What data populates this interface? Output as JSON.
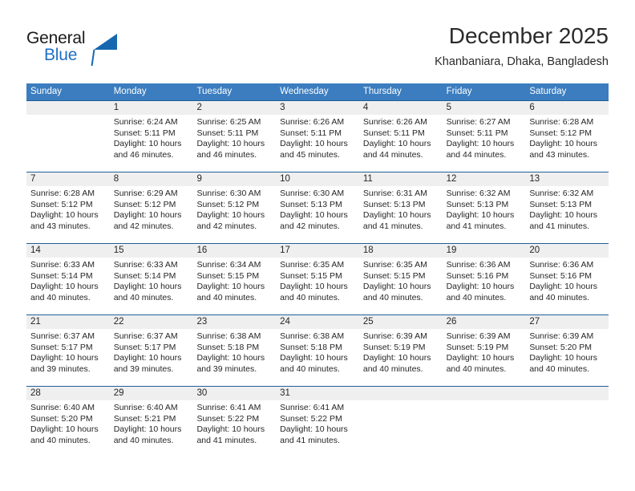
{
  "brand": {
    "word_one": "General",
    "word_two": "Blue"
  },
  "header": {
    "title": "December 2025",
    "subtitle": "Khanbaniara, Dhaka, Bangladesh"
  },
  "colors": {
    "header_blue": "#3b7dbf",
    "rule_blue": "#1f6099",
    "datenum_band": "#efefef",
    "brand_blue": "#1f6fc4",
    "text": "#262626"
  },
  "weekdays": [
    "Sunday",
    "Monday",
    "Tuesday",
    "Wednesday",
    "Thursday",
    "Friday",
    "Saturday"
  ],
  "weeks": [
    {
      "days": [
        {
          "num": "",
          "sunrise": "",
          "sunset": "",
          "daylight_1": "",
          "daylight_2": "",
          "empty": true
        },
        {
          "num": "1",
          "sunrise": "Sunrise: 6:24 AM",
          "sunset": "Sunset: 5:11 PM",
          "daylight_1": "Daylight: 10 hours",
          "daylight_2": "and 46 minutes."
        },
        {
          "num": "2",
          "sunrise": "Sunrise: 6:25 AM",
          "sunset": "Sunset: 5:11 PM",
          "daylight_1": "Daylight: 10 hours",
          "daylight_2": "and 46 minutes."
        },
        {
          "num": "3",
          "sunrise": "Sunrise: 6:26 AM",
          "sunset": "Sunset: 5:11 PM",
          "daylight_1": "Daylight: 10 hours",
          "daylight_2": "and 45 minutes."
        },
        {
          "num": "4",
          "sunrise": "Sunrise: 6:26 AM",
          "sunset": "Sunset: 5:11 PM",
          "daylight_1": "Daylight: 10 hours",
          "daylight_2": "and 44 minutes."
        },
        {
          "num": "5",
          "sunrise": "Sunrise: 6:27 AM",
          "sunset": "Sunset: 5:11 PM",
          "daylight_1": "Daylight: 10 hours",
          "daylight_2": "and 44 minutes."
        },
        {
          "num": "6",
          "sunrise": "Sunrise: 6:28 AM",
          "sunset": "Sunset: 5:12 PM",
          "daylight_1": "Daylight: 10 hours",
          "daylight_2": "and 43 minutes."
        }
      ]
    },
    {
      "days": [
        {
          "num": "7",
          "sunrise": "Sunrise: 6:28 AM",
          "sunset": "Sunset: 5:12 PM",
          "daylight_1": "Daylight: 10 hours",
          "daylight_2": "and 43 minutes."
        },
        {
          "num": "8",
          "sunrise": "Sunrise: 6:29 AM",
          "sunset": "Sunset: 5:12 PM",
          "daylight_1": "Daylight: 10 hours",
          "daylight_2": "and 42 minutes."
        },
        {
          "num": "9",
          "sunrise": "Sunrise: 6:30 AM",
          "sunset": "Sunset: 5:12 PM",
          "daylight_1": "Daylight: 10 hours",
          "daylight_2": "and 42 minutes."
        },
        {
          "num": "10",
          "sunrise": "Sunrise: 6:30 AM",
          "sunset": "Sunset: 5:13 PM",
          "daylight_1": "Daylight: 10 hours",
          "daylight_2": "and 42 minutes."
        },
        {
          "num": "11",
          "sunrise": "Sunrise: 6:31 AM",
          "sunset": "Sunset: 5:13 PM",
          "daylight_1": "Daylight: 10 hours",
          "daylight_2": "and 41 minutes."
        },
        {
          "num": "12",
          "sunrise": "Sunrise: 6:32 AM",
          "sunset": "Sunset: 5:13 PM",
          "daylight_1": "Daylight: 10 hours",
          "daylight_2": "and 41 minutes."
        },
        {
          "num": "13",
          "sunrise": "Sunrise: 6:32 AM",
          "sunset": "Sunset: 5:13 PM",
          "daylight_1": "Daylight: 10 hours",
          "daylight_2": "and 41 minutes."
        }
      ]
    },
    {
      "days": [
        {
          "num": "14",
          "sunrise": "Sunrise: 6:33 AM",
          "sunset": "Sunset: 5:14 PM",
          "daylight_1": "Daylight: 10 hours",
          "daylight_2": "and 40 minutes."
        },
        {
          "num": "15",
          "sunrise": "Sunrise: 6:33 AM",
          "sunset": "Sunset: 5:14 PM",
          "daylight_1": "Daylight: 10 hours",
          "daylight_2": "and 40 minutes."
        },
        {
          "num": "16",
          "sunrise": "Sunrise: 6:34 AM",
          "sunset": "Sunset: 5:15 PM",
          "daylight_1": "Daylight: 10 hours",
          "daylight_2": "and 40 minutes."
        },
        {
          "num": "17",
          "sunrise": "Sunrise: 6:35 AM",
          "sunset": "Sunset: 5:15 PM",
          "daylight_1": "Daylight: 10 hours",
          "daylight_2": "and 40 minutes."
        },
        {
          "num": "18",
          "sunrise": "Sunrise: 6:35 AM",
          "sunset": "Sunset: 5:15 PM",
          "daylight_1": "Daylight: 10 hours",
          "daylight_2": "and 40 minutes."
        },
        {
          "num": "19",
          "sunrise": "Sunrise: 6:36 AM",
          "sunset": "Sunset: 5:16 PM",
          "daylight_1": "Daylight: 10 hours",
          "daylight_2": "and 40 minutes."
        },
        {
          "num": "20",
          "sunrise": "Sunrise: 6:36 AM",
          "sunset": "Sunset: 5:16 PM",
          "daylight_1": "Daylight: 10 hours",
          "daylight_2": "and 40 minutes."
        }
      ]
    },
    {
      "days": [
        {
          "num": "21",
          "sunrise": "Sunrise: 6:37 AM",
          "sunset": "Sunset: 5:17 PM",
          "daylight_1": "Daylight: 10 hours",
          "daylight_2": "and 39 minutes."
        },
        {
          "num": "22",
          "sunrise": "Sunrise: 6:37 AM",
          "sunset": "Sunset: 5:17 PM",
          "daylight_1": "Daylight: 10 hours",
          "daylight_2": "and 39 minutes."
        },
        {
          "num": "23",
          "sunrise": "Sunrise: 6:38 AM",
          "sunset": "Sunset: 5:18 PM",
          "daylight_1": "Daylight: 10 hours",
          "daylight_2": "and 39 minutes."
        },
        {
          "num": "24",
          "sunrise": "Sunrise: 6:38 AM",
          "sunset": "Sunset: 5:18 PM",
          "daylight_1": "Daylight: 10 hours",
          "daylight_2": "and 40 minutes."
        },
        {
          "num": "25",
          "sunrise": "Sunrise: 6:39 AM",
          "sunset": "Sunset: 5:19 PM",
          "daylight_1": "Daylight: 10 hours",
          "daylight_2": "and 40 minutes."
        },
        {
          "num": "26",
          "sunrise": "Sunrise: 6:39 AM",
          "sunset": "Sunset: 5:19 PM",
          "daylight_1": "Daylight: 10 hours",
          "daylight_2": "and 40 minutes."
        },
        {
          "num": "27",
          "sunrise": "Sunrise: 6:39 AM",
          "sunset": "Sunset: 5:20 PM",
          "daylight_1": "Daylight: 10 hours",
          "daylight_2": "and 40 minutes."
        }
      ]
    },
    {
      "days": [
        {
          "num": "28",
          "sunrise": "Sunrise: 6:40 AM",
          "sunset": "Sunset: 5:20 PM",
          "daylight_1": "Daylight: 10 hours",
          "daylight_2": "and 40 minutes."
        },
        {
          "num": "29",
          "sunrise": "Sunrise: 6:40 AM",
          "sunset": "Sunset: 5:21 PM",
          "daylight_1": "Daylight: 10 hours",
          "daylight_2": "and 40 minutes."
        },
        {
          "num": "30",
          "sunrise": "Sunrise: 6:41 AM",
          "sunset": "Sunset: 5:22 PM",
          "daylight_1": "Daylight: 10 hours",
          "daylight_2": "and 41 minutes."
        },
        {
          "num": "31",
          "sunrise": "Sunrise: 6:41 AM",
          "sunset": "Sunset: 5:22 PM",
          "daylight_1": "Daylight: 10 hours",
          "daylight_2": "and 41 minutes."
        },
        {
          "num": "",
          "sunrise": "",
          "sunset": "",
          "daylight_1": "",
          "daylight_2": "",
          "empty": true
        },
        {
          "num": "",
          "sunrise": "",
          "sunset": "",
          "daylight_1": "",
          "daylight_2": "",
          "empty": true
        },
        {
          "num": "",
          "sunrise": "",
          "sunset": "",
          "daylight_1": "",
          "daylight_2": "",
          "empty": true
        }
      ]
    }
  ]
}
